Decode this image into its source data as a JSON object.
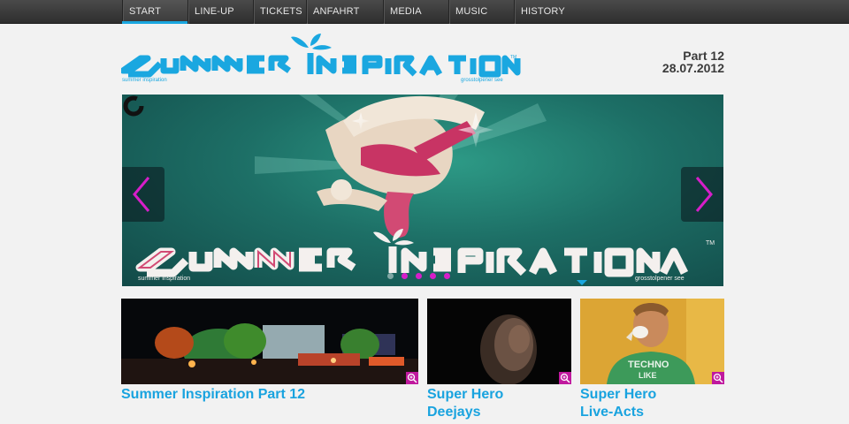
{
  "nav": {
    "items": [
      {
        "label": "Start",
        "active": true
      },
      {
        "label": "Line-Up",
        "active": false
      },
      {
        "label": "Tickets",
        "active": false
      },
      {
        "label": "Anfahrt",
        "active": false
      },
      {
        "label": "Media",
        "active": false
      },
      {
        "label": "Music",
        "active": false
      },
      {
        "label": "History",
        "active": false
      }
    ]
  },
  "header": {
    "logo_text": "SUMMER INSPIRATION",
    "logo_sub_left": "summer inspiration",
    "logo_sub_right": "grosstolpener see",
    "trademark": "TM",
    "part": "Part 12",
    "date": "28.07.2012"
  },
  "slider": {
    "logo_sub_left": "summer inspiration",
    "logo_sub_right": "grosstolpener see",
    "slide_count": 5,
    "active_slide": 1,
    "colors": {
      "accent": "#d61ec9",
      "teal": "#1d6f66"
    }
  },
  "features": [
    {
      "title": "Summer Inspiration Part 12"
    },
    {
      "title_line1": "Super Hero",
      "title_line2": "Deejays"
    },
    {
      "title_line1": "Super Hero",
      "title_line2": "Live-Acts"
    }
  ],
  "icons": {
    "prev": "chevron-left-icon",
    "next": "chevron-right-icon",
    "zoom": "magnifier-icon",
    "loader": "loading-ring-icon"
  },
  "colors": {
    "brand_blue": "#19a3df",
    "magenta": "#c0199e",
    "nav_bg": "#353535"
  }
}
